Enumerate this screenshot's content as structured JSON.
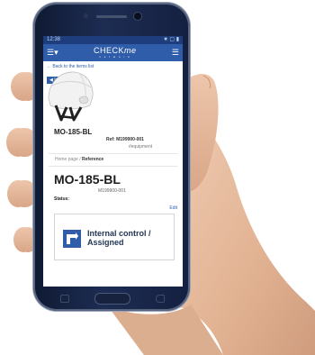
{
  "status_bar": {
    "time": "12:38",
    "right": "★ ▢ ▮"
  },
  "app_header": {
    "logo_main": "CHECK",
    "logo_me": "me",
    "logo_sub": "n e t w o r k"
  },
  "back_link": "← Back to the items list",
  "tag": "◀ Internal control",
  "product": {
    "code": "MO-185-BL",
    "ref": "Ref: M199900-001",
    "hashtag": "#equipment"
  },
  "breadcrumb": {
    "home": "Home page",
    "sep": " / ",
    "current": "Reference"
  },
  "detail": {
    "title": "MO-185-BL",
    "ref": "M199900-001",
    "status_label": "Status:",
    "edit": "Edit"
  },
  "card": {
    "title": "Internal control / Assigned"
  },
  "colors": {
    "accent": "#2f5daa",
    "statusbar": "#1d3d7c",
    "phone": "#1d2c52",
    "skin": "#e9bfa2"
  }
}
